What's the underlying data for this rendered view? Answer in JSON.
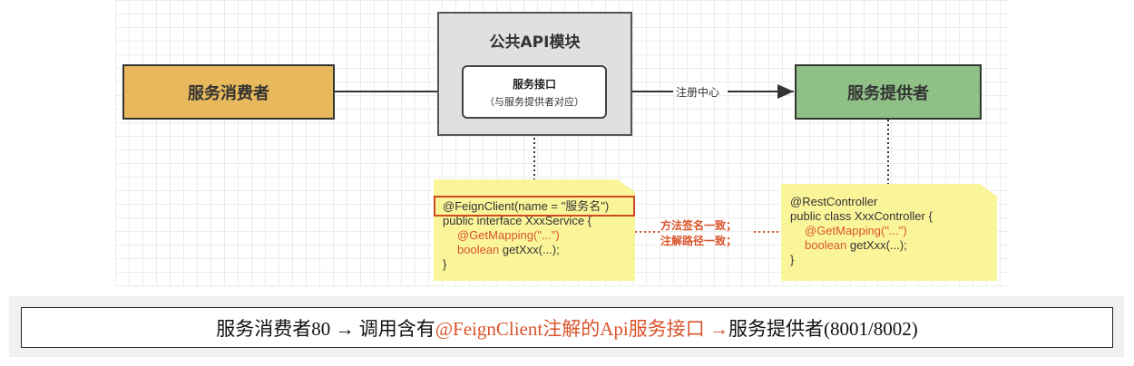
{
  "diagram": {
    "consumer": "服务消费者",
    "provider": "服务提供者",
    "module_title": "公共API模块",
    "interface_title": "服务接口",
    "interface_subtitle": "（与服务提供者对应）",
    "edge_label": "注册中心",
    "consumer_note": {
      "annotation": "@FeignClient(name = \"服务名\")",
      "line2": "public interface XxxService {",
      "line3_annotation": "@GetMapping(\"...\")",
      "line4_keyword": "boolean",
      "line4_rest": " getXxx(...);",
      "line5": "}"
    },
    "provider_note": {
      "line1": "@RestController",
      "line2": "public class XxxController {",
      "line3_annotation": "@GetMapping(\"...\")",
      "line4_keyword": "boolean",
      "line4_rest": " getXxx(...);",
      "line5": "}"
    },
    "mid_label_1": "方法签名一致；",
    "mid_label_2": "注解路径一致；"
  },
  "caption": {
    "part1": "服务消费者80 → 调用含有",
    "part2": "@FeignClient注解的Api服务接口 →",
    "part3": " 服务提供者(8001/8002)"
  },
  "colors": {
    "consumer_fill": "#e8b95c",
    "provider_fill": "#8fc187",
    "module_fill": "#e0e0e0",
    "note_fill": "#fbf59a",
    "highlight": "#d9542b"
  }
}
